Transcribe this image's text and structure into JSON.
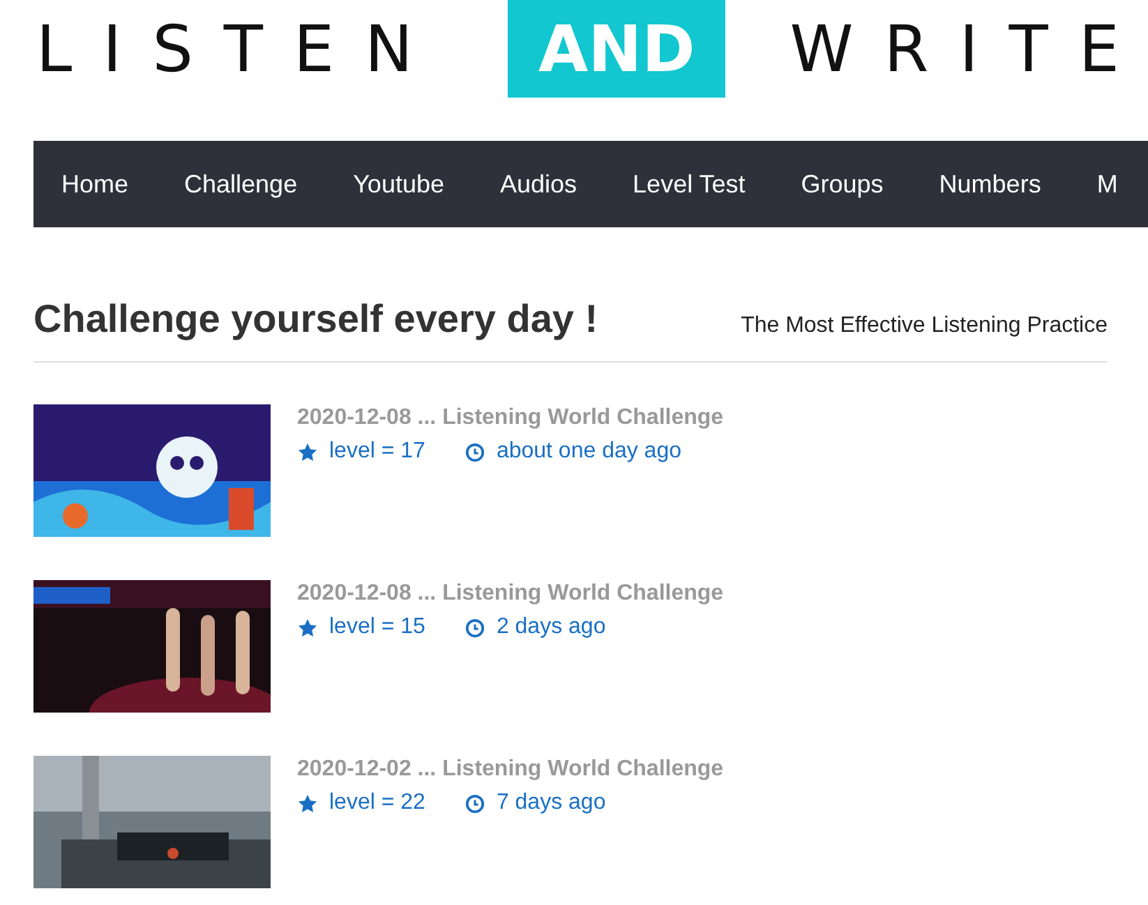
{
  "logo": {
    "words": [
      "LISTEN",
      "AND",
      "WRITE"
    ]
  },
  "nav": [
    {
      "label": "Home"
    },
    {
      "label": "Challenge"
    },
    {
      "label": "Youtube"
    },
    {
      "label": "Audios"
    },
    {
      "label": "Level Test"
    },
    {
      "label": "Groups"
    },
    {
      "label": "Numbers"
    },
    {
      "label": "M"
    }
  ],
  "heading": "Challenge yourself every day !",
  "subtitle": "The Most Effective Listening Practice",
  "items": [
    {
      "title": "2020-12-08 ... Listening World Challenge",
      "level": "level = 17",
      "time": "about one day ago"
    },
    {
      "title": "2020-12-08 ... Listening World Challenge",
      "level": "level = 15",
      "time": "2 days ago"
    },
    {
      "title": "2020-12-02 ... Listening World Challenge",
      "level": "level = 22",
      "time": "7 days ago"
    }
  ]
}
